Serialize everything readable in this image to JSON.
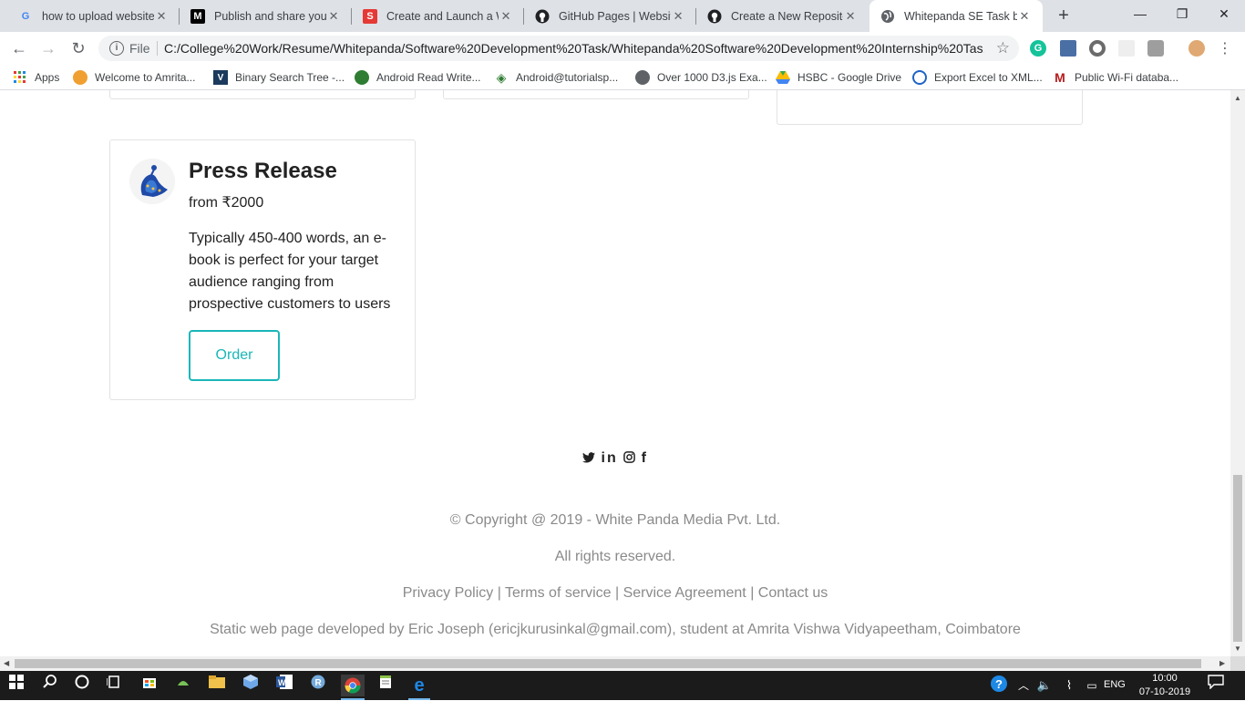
{
  "browser": {
    "tabs": [
      {
        "title": "how to upload website",
        "favicon": "G",
        "favicon_color": "#4285f4",
        "favicon_bg": "#fff",
        "active": false
      },
      {
        "title": "Publish and share your",
        "favicon": "M",
        "favicon_color": "#fff",
        "favicon_bg": "#000",
        "active": false
      },
      {
        "title": "Create and Launch a W",
        "favicon": "S",
        "favicon_color": "#fff",
        "favicon_bg": "#e53935",
        "active": false
      },
      {
        "title": "GitHub Pages | Website",
        "favicon": "●",
        "favicon_color": "#000",
        "favicon_bg": "#fff",
        "active": false
      },
      {
        "title": "Create a New Repositor",
        "favicon": "●",
        "favicon_color": "#000",
        "favicon_bg": "#fff",
        "active": false
      },
      {
        "title": "Whitepanda SE Task by",
        "favicon": "◍",
        "favicon_color": "#5f6368",
        "favicon_bg": "#fff",
        "active": true
      }
    ],
    "new_tab": "+",
    "window_controls": {
      "minimize": "—",
      "maximize": "❐",
      "close": "✕"
    },
    "nav": {
      "back": "←",
      "forward": "→",
      "reload": "↻"
    },
    "omnibox": {
      "scheme_label": "File",
      "url": "C:/College%20Work/Resume/Whitepanda/Software%20Development%20Task/Whitepanda%20Software%20Development%20Internship%20Tas..."
    },
    "bookmarks": [
      {
        "label": "Apps",
        "icon": "apps-grid-icon"
      },
      {
        "label": "Welcome to Amrita...",
        "icon": "amrita-icon"
      },
      {
        "label": "Binary Search Tree -...",
        "icon": "v-icon"
      },
      {
        "label": "Android Read Write...",
        "icon": "android-icon"
      },
      {
        "label": "Android@tutorialsp...",
        "icon": "diamond-icon"
      },
      {
        "label": "Over 1000 D3.js Exa...",
        "icon": "globe-icon"
      },
      {
        "label": "HSBC - Google Drive",
        "icon": "drive-icon"
      },
      {
        "label": "Export Excel to XML...",
        "icon": "export-icon"
      },
      {
        "label": "Public Wi-Fi databa...",
        "icon": "m-icon"
      }
    ]
  },
  "page": {
    "card": {
      "title": "Press Release",
      "price": "from ₹2000",
      "description": "Typically 450-400 words, an e-book is perfect for your target audience ranging from prospective customers to users",
      "button": "Order"
    },
    "social_icons": [
      "twitter-icon",
      "linkedin-icon",
      "instagram-icon",
      "facebook-icon"
    ],
    "social_glyphs": {
      "twitter": "🐦",
      "linkedin": "in",
      "instagram": "◎",
      "facebook": "f"
    },
    "footer": {
      "copyright": "© Copyright @ 2019 - White Panda Media Pvt. Ltd.",
      "rights": "All rights reserved.",
      "links": [
        "Privacy Policy",
        "Terms of service",
        "Service Agreement",
        "Contact us"
      ],
      "link_separator": " | ",
      "credit": "Static web page developed by Eric Joseph (ericjkurusinkal@gmail.com), student at Amrita Vishwa Vidyapeetham, Coimbatore"
    },
    "accent_color": "#1ab6b8"
  },
  "taskbar": {
    "language": "ENG",
    "time": "10:00",
    "date": "07-10-2019"
  }
}
